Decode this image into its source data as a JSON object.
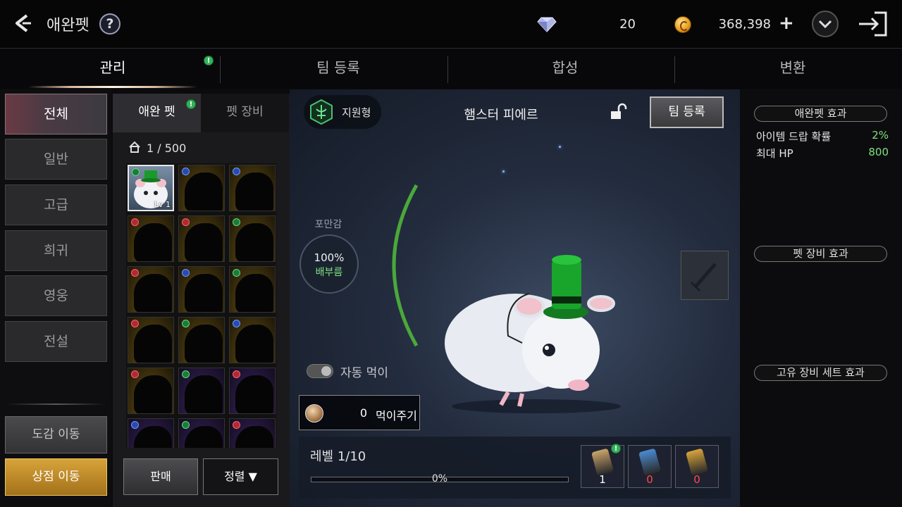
{
  "header": {
    "title": "애완펫",
    "help_label": "?",
    "gem_value": "20",
    "coin_value": "368,398",
    "plus_label": "+"
  },
  "tabs": [
    {
      "label": "관리",
      "active": true,
      "badge": "!"
    },
    {
      "label": "팀 등록",
      "active": false
    },
    {
      "label": "합성",
      "active": false
    },
    {
      "label": "변환",
      "active": false
    }
  ],
  "categories": [
    {
      "label": "전체",
      "active": true
    },
    {
      "label": "일반",
      "active": false
    },
    {
      "label": "고급",
      "active": false
    },
    {
      "label": "희귀",
      "active": false
    },
    {
      "label": "영웅",
      "active": false
    },
    {
      "label": "전설",
      "active": false
    }
  ],
  "left_buttons": {
    "codex": "도감 이동",
    "shop": "상점 이동"
  },
  "pet_list": {
    "subtabs": [
      {
        "label": "애완 펫",
        "active": true,
        "badge": "!"
      },
      {
        "label": "펫 장비",
        "active": false
      }
    ],
    "count": "1 / 500",
    "first_slot_level": "Lv 1",
    "slots": [
      {
        "bg": "first",
        "gem": "green"
      },
      {
        "bg": "gold",
        "gem": "blue"
      },
      {
        "bg": "gold",
        "gem": "blue"
      },
      {
        "bg": "gold",
        "gem": "red"
      },
      {
        "bg": "gold",
        "gem": "red"
      },
      {
        "bg": "gold",
        "gem": "green"
      },
      {
        "bg": "gold",
        "gem": "red"
      },
      {
        "bg": "gold",
        "gem": "blue"
      },
      {
        "bg": "gold",
        "gem": "green"
      },
      {
        "bg": "gold",
        "gem": "red"
      },
      {
        "bg": "gold",
        "gem": "green"
      },
      {
        "bg": "gold",
        "gem": "blue"
      },
      {
        "bg": "gold",
        "gem": "red"
      },
      {
        "bg": "purple",
        "gem": "green"
      },
      {
        "bg": "purple",
        "gem": "red"
      },
      {
        "bg": "purple",
        "gem": "blue"
      },
      {
        "bg": "purple",
        "gem": "green"
      },
      {
        "bg": "purple",
        "gem": "red"
      }
    ],
    "sell_label": "판매",
    "sort_label": "정렬 ▼"
  },
  "pet": {
    "role": "지원형",
    "name": "햄스터 피에르",
    "team_button": "팀 등록",
    "satiety_label": "포만감",
    "satiety_percent": "100%",
    "satiety_state": "배부름",
    "satiety_ratio": 1.0,
    "auto_feed_label": "자동 먹이",
    "feed_count": "0",
    "feed_label": "먹이주기",
    "level_label": "레벨 1/10",
    "progress_text": "0%",
    "progress_ratio": 0,
    "items": [
      {
        "count": "1",
        "color": "#ffffff",
        "badge": "!",
        "scroll": "#c9a46a"
      },
      {
        "count": "0",
        "color": "#ff4a4a",
        "scroll": "#4a8ad0"
      },
      {
        "count": "0",
        "color": "#ff4a4a",
        "scroll": "#d8a43a"
      }
    ]
  },
  "effects": {
    "pet_effect_title": "애완펫 효과",
    "stats": [
      {
        "name": "아이템 드랍 확률",
        "value": "2%"
      },
      {
        "name": "최대 HP",
        "value": "800"
      }
    ],
    "equip_effect_title": "펫 장비 효과",
    "set_effect_title": "고유 장비 세트 효과"
  }
}
